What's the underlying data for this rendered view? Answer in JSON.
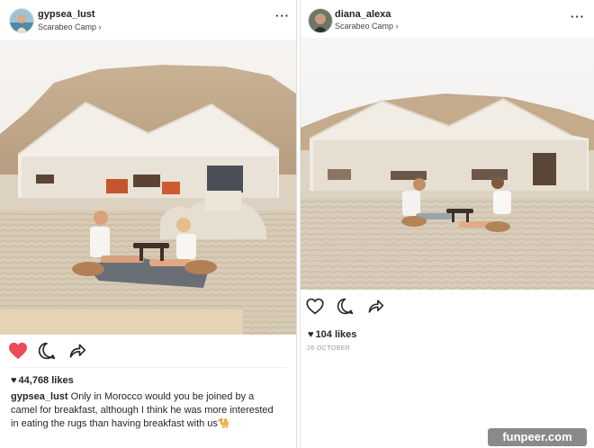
{
  "left_post": {
    "username": "gypsea_lust",
    "location": "Scarabeo Camp ›",
    "likes": "44,768 likes",
    "caption_user": "gypsea_lust",
    "caption_text": "Only in Morocco would you be joined by a camel for breakfast, although I think he was more interested in eating the rugs than having breakfast with us🐪",
    "liked": true
  },
  "right_post": {
    "username": "diana_alexa",
    "location": "Scarabeo Camp ›",
    "likes": "104 likes",
    "date": "26 OCTOBER",
    "liked": false
  },
  "icons": {
    "more": "more-options-icon",
    "like": "heart-icon",
    "comment": "comment-icon",
    "share": "share-icon"
  },
  "colors": {
    "like_red": "#ed4956",
    "text": "#262626",
    "secondary": "#999999"
  },
  "watermark": "funpeer.com"
}
